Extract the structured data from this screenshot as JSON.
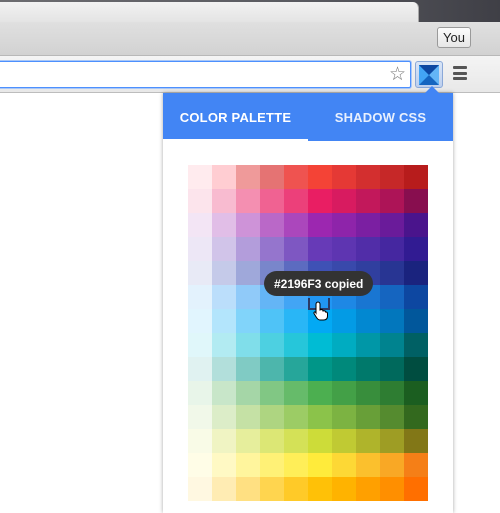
{
  "browser": {
    "profile_label": "You",
    "bookmark_icon": "star-icon",
    "extension_icon": "color-palette-extension-icon",
    "menu_icon": "hamburger-menu-icon"
  },
  "popup": {
    "tabs": [
      {
        "label": "COLOR PALETTE",
        "active": true
      },
      {
        "label": "SHADOW CSS",
        "active": false
      }
    ],
    "accent": "#4285F4",
    "tooltip": "#2196F3 copied",
    "cursor_icon": "hand-pointer-icon",
    "palette": [
      [
        "#FFEBEE",
        "#FFCDD2",
        "#EF9A9A",
        "#E57373",
        "#EF5350",
        "#F44336",
        "#E53935",
        "#D32F2F",
        "#C62828",
        "#B71C1C"
      ],
      [
        "#FCE4EC",
        "#F8BBD0",
        "#F48FB1",
        "#F06292",
        "#EC407A",
        "#E91E63",
        "#D81B60",
        "#C2185B",
        "#AD1457",
        "#880E4F"
      ],
      [
        "#F3E5F5",
        "#E1BEE7",
        "#CE93D8",
        "#BA68C8",
        "#AB47BC",
        "#9C27B0",
        "#8E24AA",
        "#7B1FA2",
        "#6A1B9A",
        "#4A148C"
      ],
      [
        "#EDE7F6",
        "#D1C4E9",
        "#B39DDB",
        "#9575CD",
        "#7E57C2",
        "#673AB7",
        "#5E35B1",
        "#512DA8",
        "#4527A0",
        "#311B92"
      ],
      [
        "#E8EAF6",
        "#C5CAE9",
        "#9FA8DA",
        "#7986CB",
        "#5C6BC0",
        "#3F51B5",
        "#3949AB",
        "#303F9F",
        "#283593",
        "#1A237E"
      ],
      [
        "#E3F2FD",
        "#BBDEFB",
        "#90CAF9",
        "#64B5F6",
        "#42A5F5",
        "#2196F3",
        "#1E88E5",
        "#1976D2",
        "#1565C0",
        "#0D47A1"
      ],
      [
        "#E1F5FE",
        "#B3E5FC",
        "#81D4FA",
        "#4FC3F7",
        "#29B6F6",
        "#03A9F4",
        "#039BE5",
        "#0288D1",
        "#0277BD",
        "#01579B"
      ],
      [
        "#E0F7FA",
        "#B2EBF2",
        "#80DEEA",
        "#4DD0E1",
        "#26C6DA",
        "#00BCD4",
        "#00ACC1",
        "#0097A7",
        "#00838F",
        "#006064"
      ],
      [
        "#E0F2F1",
        "#B2DFDB",
        "#80CBC4",
        "#4DB6AC",
        "#26A69A",
        "#009688",
        "#00897B",
        "#00796B",
        "#00695C",
        "#004D40"
      ],
      [
        "#E8F5E9",
        "#C8E6C9",
        "#A5D6A7",
        "#81C784",
        "#66BB6A",
        "#4CAF50",
        "#43A047",
        "#388E3C",
        "#2E7D32",
        "#1B5E20"
      ],
      [
        "#F1F8E9",
        "#DCEDC8",
        "#C5E1A5",
        "#AED581",
        "#9CCC65",
        "#8BC34A",
        "#7CB342",
        "#689F38",
        "#558B2F",
        "#33691E"
      ],
      [
        "#F9FBE7",
        "#F0F4C3",
        "#E6EE9C",
        "#DCE775",
        "#D4E157",
        "#CDDC39",
        "#C0CA33",
        "#AFB42B",
        "#9E9D24",
        "#827717"
      ],
      [
        "#FFFDE7",
        "#FFF9C4",
        "#FFF59D",
        "#FFF176",
        "#FFEE58",
        "#FFEB3B",
        "#FDD835",
        "#FBC02D",
        "#F9A825",
        "#F57F17"
      ],
      [
        "#FFF8E1",
        "#FFECB3",
        "#FFE082",
        "#FFD54F",
        "#FFCA28",
        "#FFC107",
        "#FFB300",
        "#FFA000",
        "#FF8F00",
        "#FF6F00"
      ]
    ]
  }
}
